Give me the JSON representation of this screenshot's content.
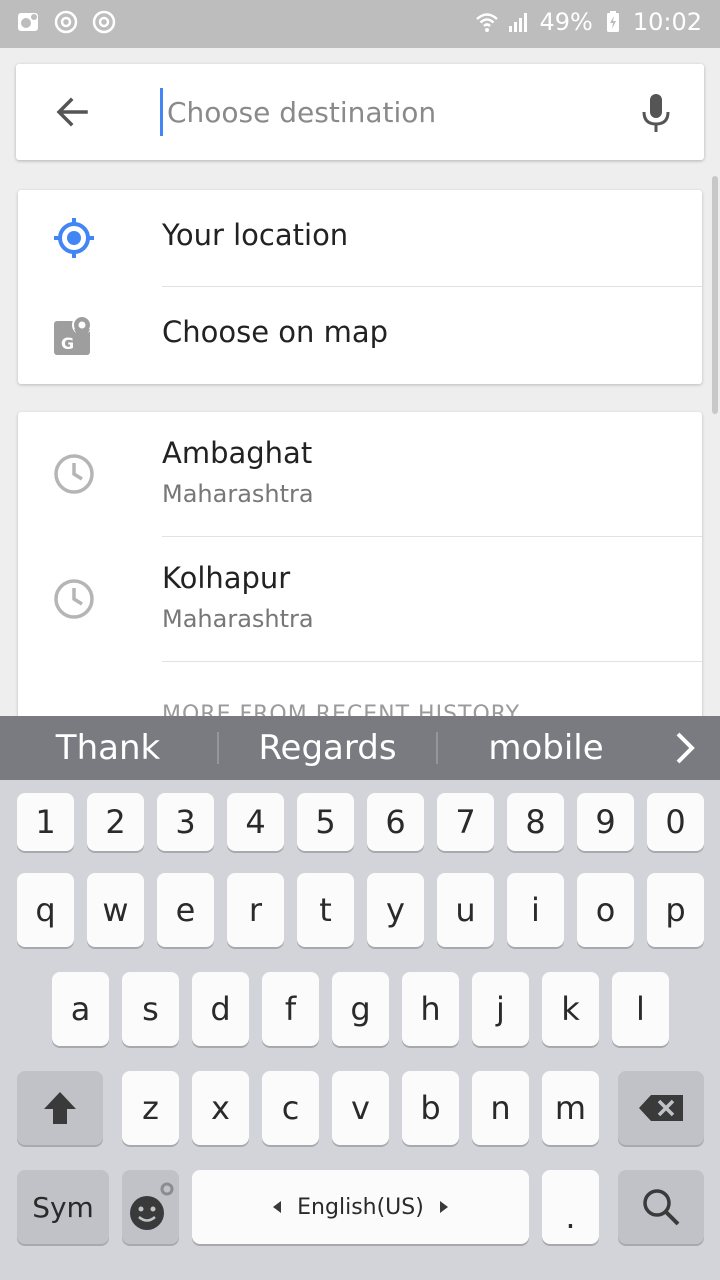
{
  "status": {
    "battery": "49%",
    "time": "10:02",
    "icons_left": [
      "gallery-icon",
      "chrome-icon",
      "chrome-icon"
    ],
    "icons_right": [
      "wifi-icon",
      "signal-icon",
      "battery-charging-icon"
    ]
  },
  "search": {
    "placeholder": "Choose destination",
    "value": ""
  },
  "locations": {
    "your_location": "Your location",
    "choose_on_map": "Choose on map"
  },
  "recent": [
    {
      "title": "Ambaghat",
      "subtitle": "Maharashtra"
    },
    {
      "title": "Kolhapur",
      "subtitle": "Maharashtra"
    }
  ],
  "more_history_label": "MORE FROM RECENT HISTORY",
  "keyboard": {
    "suggestions": [
      "Thank",
      "Regards",
      "mobile"
    ],
    "numbers": [
      "1",
      "2",
      "3",
      "4",
      "5",
      "6",
      "7",
      "8",
      "9",
      "0"
    ],
    "row1": [
      "q",
      "w",
      "e",
      "r",
      "t",
      "y",
      "u",
      "i",
      "o",
      "p"
    ],
    "row2": [
      "a",
      "s",
      "d",
      "f",
      "g",
      "h",
      "j",
      "k",
      "l"
    ],
    "row3": [
      "z",
      "x",
      "c",
      "v",
      "b",
      "n",
      "m"
    ],
    "sym_label": "Sym",
    "space_label": "English(US)",
    "period_label": "."
  },
  "colors": {
    "accent": "#4285f4",
    "statusbar": "#bdbdbd",
    "suggestion_bar": "#7a7b80",
    "keyboard_bg": "#d3d4d9"
  }
}
